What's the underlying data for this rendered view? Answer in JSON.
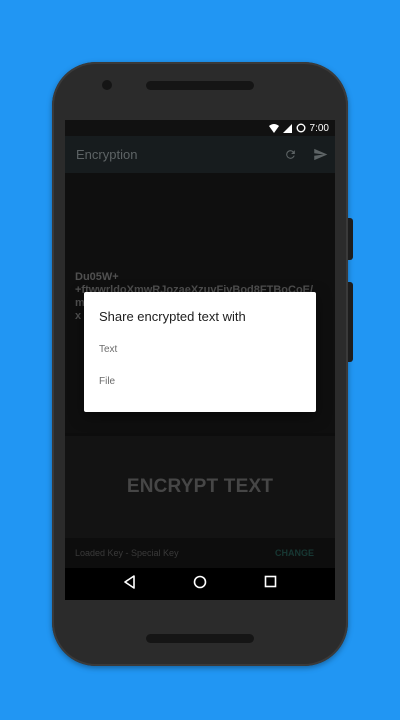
{
  "statusbar": {
    "time": "7:00"
  },
  "appbar": {
    "title": "Encryption",
    "refresh_icon": "refresh-icon",
    "send_icon": "send-icon"
  },
  "content": {
    "encrypted_lines": [
      "Du05W+",
      "+ftwwrldoXmwRJozaeXzuvFivBod8FTBoCoE/",
      "m",
      "x"
    ]
  },
  "encrypt_button": {
    "label": "ENCRYPT TEXT"
  },
  "bottombar": {
    "key_label": "Loaded Key - Special Key",
    "change_label": "CHANGE"
  },
  "dialog": {
    "title": "Share encrypted text with",
    "options": [
      "Text",
      "File"
    ]
  },
  "navbar": {
    "back_icon": "back-icon",
    "home_icon": "home-icon",
    "recents_icon": "recents-icon"
  },
  "colors": {
    "background": "#2196F3",
    "accent": "#1f4a44",
    "appbar": "#1f2628"
  }
}
